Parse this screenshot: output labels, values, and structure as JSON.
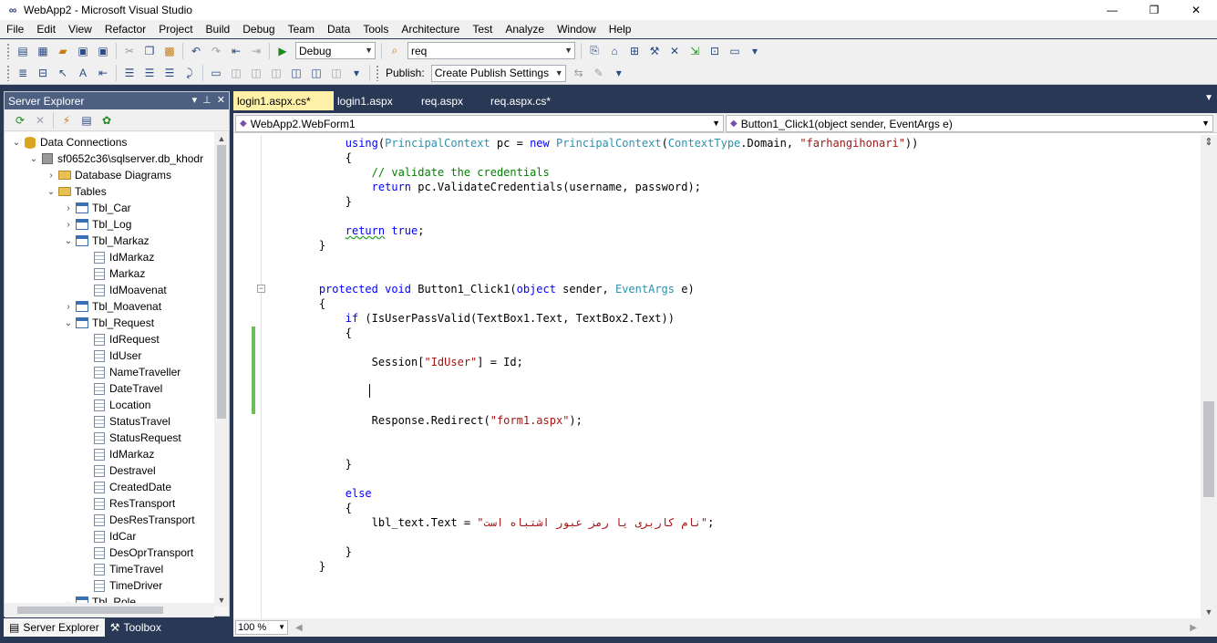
{
  "window": {
    "title": "WebApp2 - Microsoft Visual Studio",
    "controls": {
      "minimize": "—",
      "restore": "❐",
      "close": "✕"
    }
  },
  "menu": [
    "File",
    "Edit",
    "View",
    "Refactor",
    "Project",
    "Build",
    "Debug",
    "Team",
    "Data",
    "Tools",
    "Architecture",
    "Test",
    "Analyze",
    "Window",
    "Help"
  ],
  "toolbar": {
    "config_value": "Debug",
    "find_value": "req",
    "publish_label": "Publish:",
    "publish_value": "Create Publish Settings"
  },
  "server_explorer": {
    "title": "Server Explorer",
    "header_icons": {
      "dropdown": "▾",
      "pin": "⊥",
      "close": "✕"
    },
    "tree": [
      {
        "label": "Data Connections",
        "level": 0,
        "expander": "down",
        "icon": "database-icon"
      },
      {
        "label": "sf0652c36\\sqlserver.db_khodr",
        "level": 1,
        "expander": "down",
        "icon": "server-icon"
      },
      {
        "label": "Database Diagrams",
        "level": 2,
        "expander": "right",
        "icon": "folder-icon"
      },
      {
        "label": "Tables",
        "level": 2,
        "expander": "down",
        "icon": "folder-icon"
      },
      {
        "label": "Tbl_Car",
        "level": 3,
        "expander": "right",
        "icon": "table-icon"
      },
      {
        "label": "Tbl_Log",
        "level": 3,
        "expander": "right",
        "icon": "table-icon"
      },
      {
        "label": "Tbl_Markaz",
        "level": 3,
        "expander": "down",
        "icon": "table-icon"
      },
      {
        "label": "IdMarkaz",
        "level": 4,
        "expander": "none",
        "icon": "column-icon"
      },
      {
        "label": "Markaz",
        "level": 4,
        "expander": "none",
        "icon": "column-icon"
      },
      {
        "label": "IdMoavenat",
        "level": 4,
        "expander": "none",
        "icon": "column-icon"
      },
      {
        "label": "Tbl_Moavenat",
        "level": 3,
        "expander": "right",
        "icon": "table-icon"
      },
      {
        "label": "Tbl_Request",
        "level": 3,
        "expander": "down",
        "icon": "table-icon"
      },
      {
        "label": "IdRequest",
        "level": 4,
        "expander": "none",
        "icon": "column-icon"
      },
      {
        "label": "IdUser",
        "level": 4,
        "expander": "none",
        "icon": "column-icon"
      },
      {
        "label": "NameTraveller",
        "level": 4,
        "expander": "none",
        "icon": "column-icon"
      },
      {
        "label": "DateTravel",
        "level": 4,
        "expander": "none",
        "icon": "column-icon"
      },
      {
        "label": "Location",
        "level": 4,
        "expander": "none",
        "icon": "column-icon"
      },
      {
        "label": "StatusTravel",
        "level": 4,
        "expander": "none",
        "icon": "column-icon"
      },
      {
        "label": "StatusRequest",
        "level": 4,
        "expander": "none",
        "icon": "column-icon"
      },
      {
        "label": "IdMarkaz",
        "level": 4,
        "expander": "none",
        "icon": "column-icon"
      },
      {
        "label": "Destravel",
        "level": 4,
        "expander": "none",
        "icon": "column-icon"
      },
      {
        "label": "CreatedDate",
        "level": 4,
        "expander": "none",
        "icon": "column-icon"
      },
      {
        "label": "ResTransport",
        "level": 4,
        "expander": "none",
        "icon": "column-icon"
      },
      {
        "label": "DesResTransport",
        "level": 4,
        "expander": "none",
        "icon": "column-icon"
      },
      {
        "label": "IdCar",
        "level": 4,
        "expander": "none",
        "icon": "column-icon"
      },
      {
        "label": "DesOprTransport",
        "level": 4,
        "expander": "none",
        "icon": "column-icon"
      },
      {
        "label": "TimeTravel",
        "level": 4,
        "expander": "none",
        "icon": "column-icon"
      },
      {
        "label": "TimeDriver",
        "level": 4,
        "expander": "none",
        "icon": "column-icon"
      },
      {
        "label": "Tbl_Role",
        "level": 3,
        "expander": "down",
        "icon": "table-icon"
      }
    ],
    "bottom_tabs": [
      {
        "label": "Server Explorer",
        "icon": "server-explorer-icon"
      },
      {
        "label": "Toolbox",
        "icon": "toolbox-icon"
      }
    ]
  },
  "editor": {
    "tabs": [
      {
        "label": "login1.aspx.cs*",
        "active": true
      },
      {
        "label": "login1.aspx",
        "active": false
      },
      {
        "label": "req.aspx",
        "active": false
      },
      {
        "label": "req.aspx.cs*",
        "active": false
      }
    ],
    "nav_left": "WebApp2.WebForm1",
    "nav_right": "Button1_Click1(object sender, EventArgs e)",
    "zoom": "100 %",
    "code": [
      {
        "row": 0,
        "indent": 12,
        "tokens": [
          [
            "kw",
            "using"
          ],
          [
            "",
            "("
          ],
          [
            "ty",
            "PrincipalContext"
          ],
          [
            "",
            " pc = "
          ],
          [
            "kw",
            "new"
          ],
          [
            "",
            " "
          ],
          [
            "ty",
            "PrincipalContext"
          ],
          [
            "",
            "("
          ],
          [
            "ty",
            "ContextType"
          ],
          [
            "",
            ".Domain, "
          ],
          [
            "str",
            "\"farhangihonari\""
          ],
          [
            "",
            "))"
          ]
        ]
      },
      {
        "row": 1,
        "indent": 12,
        "tokens": [
          [
            "",
            "{"
          ]
        ]
      },
      {
        "row": 2,
        "indent": 16,
        "tokens": [
          [
            "cm",
            "// validate the credentials"
          ]
        ]
      },
      {
        "row": 3,
        "indent": 16,
        "tokens": [
          [
            "kw",
            "return"
          ],
          [
            "",
            " pc.ValidateCredentials(username, password);"
          ]
        ]
      },
      {
        "row": 4,
        "indent": 12,
        "tokens": [
          [
            "",
            "}"
          ]
        ]
      },
      {
        "row": 6,
        "indent": 12,
        "tokens": [
          [
            "kw squig",
            "return"
          ],
          [
            "",
            " "
          ],
          [
            "kw",
            "true"
          ],
          [
            "",
            ";"
          ]
        ]
      },
      {
        "row": 7,
        "indent": 8,
        "tokens": [
          [
            "",
            "}"
          ]
        ]
      },
      {
        "row": 10,
        "indent": 8,
        "tokens": [
          [
            "kw",
            "protected"
          ],
          [
            "",
            " "
          ],
          [
            "kw",
            "void"
          ],
          [
            "",
            " Button1_Click1("
          ],
          [
            "kw",
            "object"
          ],
          [
            "",
            " sender, "
          ],
          [
            "ty",
            "EventArgs"
          ],
          [
            "",
            " e)"
          ]
        ]
      },
      {
        "row": 11,
        "indent": 8,
        "tokens": [
          [
            "",
            "{"
          ]
        ]
      },
      {
        "row": 12,
        "indent": 12,
        "tokens": [
          [
            "kw",
            "if"
          ],
          [
            "",
            " (IsUserPassValid(TextBox1.Text, TextBox2.Text))"
          ]
        ]
      },
      {
        "row": 13,
        "indent": 12,
        "tokens": [
          [
            "",
            "{"
          ]
        ]
      },
      {
        "row": 15,
        "indent": 16,
        "tokens": [
          [
            "",
            "Session["
          ],
          [
            "str",
            "\"IdUser\""
          ],
          [
            "",
            "] = Id;"
          ]
        ]
      },
      {
        "row": 19,
        "indent": 16,
        "tokens": [
          [
            "",
            "Response.Redirect("
          ],
          [
            "str",
            "\"form1.aspx\""
          ],
          [
            "",
            ");"
          ]
        ]
      },
      {
        "row": 22,
        "indent": 12,
        "tokens": [
          [
            "",
            "}"
          ]
        ]
      },
      {
        "row": 24,
        "indent": 12,
        "tokens": [
          [
            "kw",
            "else"
          ]
        ]
      },
      {
        "row": 25,
        "indent": 12,
        "tokens": [
          [
            "",
            "{"
          ]
        ]
      },
      {
        "row": 26,
        "indent": 16,
        "tokens": [
          [
            "",
            "lbl_text.Text = "
          ],
          [
            "str",
            "\"نام کاربری یا رمز عبور اشتباه است\""
          ],
          [
            "",
            ";"
          ]
        ]
      },
      {
        "row": 28,
        "indent": 12,
        "tokens": [
          [
            "",
            "}"
          ]
        ]
      },
      {
        "row": 29,
        "indent": 8,
        "tokens": [
          [
            "",
            "}"
          ]
        ]
      }
    ]
  }
}
